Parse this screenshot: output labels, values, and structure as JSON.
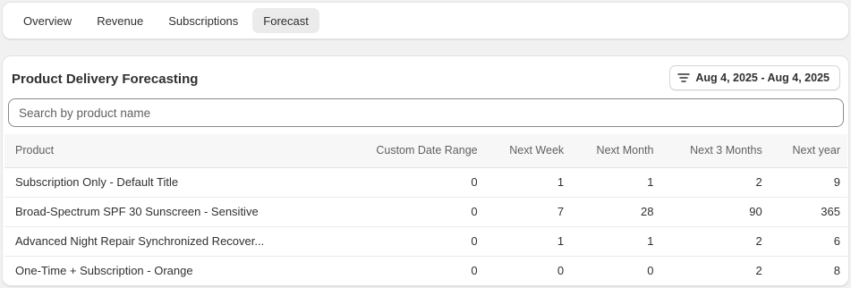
{
  "tabs": [
    {
      "label": "Overview",
      "active": false
    },
    {
      "label": "Revenue",
      "active": false
    },
    {
      "label": "Subscriptions",
      "active": false
    },
    {
      "label": "Forecast",
      "active": true
    }
  ],
  "forecast": {
    "title": "Product Delivery Forecasting",
    "date_range_label": "Aug 4, 2025 - Aug 4, 2025",
    "search": {
      "placeholder": "Search by product name",
      "value": ""
    },
    "table": {
      "headers": [
        "Product",
        "Custom Date Range",
        "Next Week",
        "Next Month",
        "Next 3 Months",
        "Next year"
      ],
      "rows": [
        [
          "Subscription Only - Default Title",
          "0",
          "1",
          "1",
          "2",
          "9"
        ],
        [
          "Broad-Spectrum SPF 30 Sunscreen - Sensitive",
          "0",
          "7",
          "28",
          "90",
          "365"
        ],
        [
          "Advanced Night Repair Synchronized Recover...",
          "0",
          "1",
          "1",
          "2",
          "6"
        ],
        [
          "One-Time + Subscription - Orange",
          "0",
          "0",
          "0",
          "2",
          "8"
        ]
      ]
    }
  },
  "colors": {
    "background": "#f1f1f1",
    "card": "#ffffff",
    "active_tab": "#ebebeb",
    "text": "#303030",
    "muted_text": "#616161"
  },
  "icons": {
    "date_button": "filter-lines-icon"
  }
}
